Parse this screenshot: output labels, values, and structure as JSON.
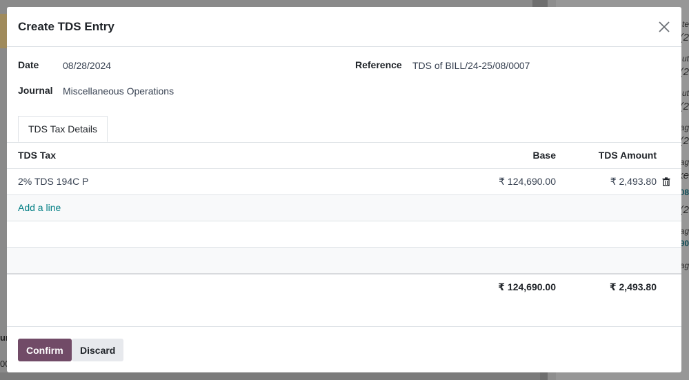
{
  "background": {
    "right_items": [
      "te",
      "(2",
      "ut",
      "(2",
      "ut",
      "(2",
      "ag",
      "(2",
      "ag",
      "ke",
      "08",
      "(2",
      "ag",
      "90",
      "ag"
    ],
    "left_items": [
      "ur",
      "00"
    ]
  },
  "modal": {
    "title": "Create TDS Entry",
    "fields": {
      "date_label": "Date",
      "date_value": "08/28/2024",
      "journal_label": "Journal",
      "journal_value": "Miscellaneous Operations",
      "reference_label": "Reference",
      "reference_value": "TDS of BILL/24-25/08/0007"
    },
    "tab": "TDS Tax Details",
    "table": {
      "headers": {
        "tax": "TDS Tax",
        "base": "Base",
        "amount": "TDS Amount"
      },
      "rows": [
        {
          "tax": "2% TDS 194C P",
          "base": "₹ 124,690.00",
          "amount": "₹ 2,493.80"
        }
      ],
      "add_line": "Add a line",
      "totals": {
        "base": "₹ 124,690.00",
        "amount": "₹ 2,493.80"
      }
    },
    "footer": {
      "confirm_label": "Confirm",
      "discard_label": "Discard"
    }
  },
  "colors": {
    "primary": "#714b67",
    "link": "#017e84",
    "secondary_btn": "#e7e9ed"
  },
  "icons": [
    "close-icon",
    "trash-icon"
  ]
}
